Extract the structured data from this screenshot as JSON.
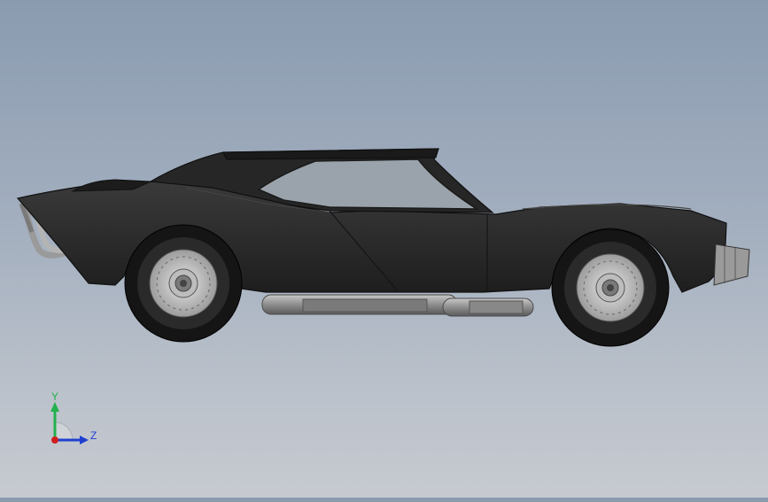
{
  "view": {
    "background_top": "#8a9bb0",
    "background_bottom": "#c6cad0",
    "model_color": "#2b2b2b",
    "glass_color": "#9aa3ab",
    "exhaust_color": "#8a8a8a"
  },
  "triad": {
    "y_label": "Y",
    "z_label": "Z",
    "y_color": "#22b14c",
    "z_color": "#1f3fd0",
    "x_color": "#d01f1f"
  }
}
